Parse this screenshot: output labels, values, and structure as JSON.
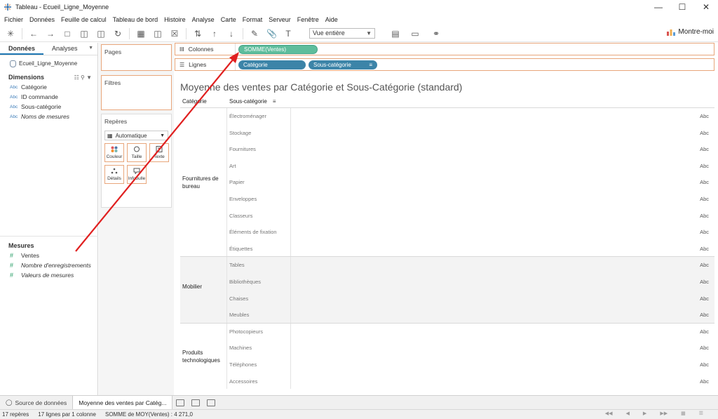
{
  "window": {
    "title": "Tableau - Ecueil_Ligne_Moyenne"
  },
  "menu": [
    "Fichier",
    "Données",
    "Feuille de calcul",
    "Tableau de bord",
    "Histoire",
    "Analyse",
    "Carte",
    "Format",
    "Serveur",
    "Fenêtre",
    "Aide"
  ],
  "toolbar": {
    "fit_select": "Vue entière",
    "show_me": "Montre-moi"
  },
  "datapane": {
    "tabs": [
      "Données",
      "Analyses"
    ],
    "datasource": "Ecueil_Ligne_Moyenne",
    "dimensions_title": "Dimensions",
    "dimensions": [
      {
        "type": "Abc",
        "label": "Catégorie"
      },
      {
        "type": "Abc",
        "label": "ID commande"
      },
      {
        "type": "Abc",
        "label": "Sous-catégorie"
      },
      {
        "type": "Abc",
        "label": "Noms de mesures"
      }
    ],
    "measures_title": "Mesures",
    "measures": [
      {
        "type": "#",
        "label": "Ventes"
      },
      {
        "type": "#",
        "label": "Nombre d'enregistrements"
      },
      {
        "type": "#",
        "label": "Valeurs de mesures"
      }
    ]
  },
  "cards": {
    "pages": "Pages",
    "filters": "Filtres",
    "marks": "Repères",
    "mark_type": "Automatique",
    "mark_buttons": [
      "Couleur",
      "Taille",
      "Texte",
      "Détails",
      "Infobulle"
    ]
  },
  "shelves": {
    "columns_label": "Colonnes",
    "columns_pill": "SOMME(Ventes)",
    "rows_label": "Lignes",
    "rows_pills": [
      "Catégorie",
      "Sous-catégorie"
    ]
  },
  "view": {
    "title": "Moyenne des ventes par Catégorie et Sous-Catégorie (standard)",
    "col_headers": [
      "Catégorie",
      "Sous-catégorie"
    ],
    "cell_text": "Abc",
    "categories": [
      {
        "name": "Fournitures de bureau",
        "subs": [
          "Électroménager",
          "Stockage",
          "Fournitures",
          "Art",
          "Papier",
          "Enveloppes",
          "Classeurs",
          "Éléments de fixation",
          "Étiquettes"
        ]
      },
      {
        "name": "Mobilier",
        "subs": [
          "Tables",
          "Bibliothèques",
          "Chaises",
          "Meubles"
        ]
      },
      {
        "name": "Produits technologiques",
        "subs": [
          "Photocopieurs",
          "Machines",
          "Téléphones",
          "Accessoires"
        ]
      }
    ]
  },
  "sheets": {
    "datasource_tab": "Source de données",
    "active_tab": "Moyenne des ventes par Catég..."
  },
  "status": {
    "marks": "17 repères",
    "rows_cols": "17 lignes par 1 colonne",
    "sum": "SOMME de MOY(Ventes) : 4 271,0"
  },
  "colors": {
    "accent_orange": "#e8a67b",
    "pill_green": "#5ebd9c",
    "pill_blue": "#3c84a8",
    "arrow_red": "#e02020"
  }
}
